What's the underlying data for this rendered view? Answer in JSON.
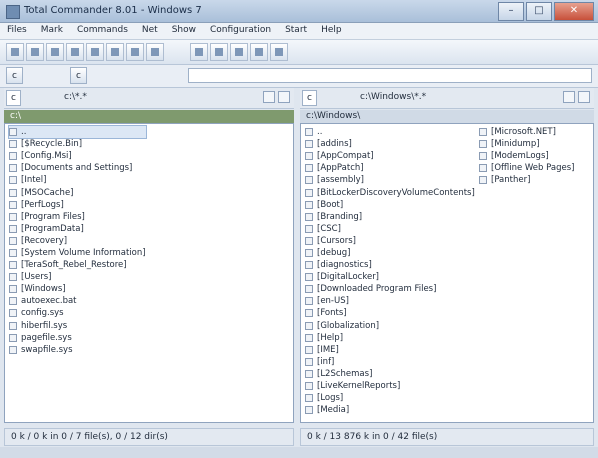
{
  "window": {
    "title": "Total Commander 8.01 - Windows 7"
  },
  "menu": [
    "Files",
    "Mark",
    "Commands",
    "Net",
    "Show",
    "Configuration",
    "Start",
    "Help"
  ],
  "drives": {
    "left": "c",
    "right": "c",
    "toolbar_left": "c",
    "toolbar_right": "c"
  },
  "left": {
    "path": "c:\\*.*",
    "header": "c:\\",
    "items": [
      "..",
      "[$Recycle.Bin]",
      "[Config.Msi]",
      "[Documents and Settings]",
      "[Intel]",
      "[MSOCache]",
      "[PerfLogs]",
      "[Program Files]",
      "[ProgramData]",
      "[Recovery]",
      "[System Volume Information]",
      "[TeraSoft_Rebel_Restore]",
      "[Users]",
      "[Windows]",
      "autoexec.bat",
      "config.sys",
      "hiberfil.sys",
      "pagefile.sys",
      "swapfile.sys"
    ],
    "status": "0 k / 0 k in 0 / 7 file(s), 0 / 12 dir(s)"
  },
  "right": {
    "path": "c:\\Windows\\*.*",
    "header": "c:\\Windows\\",
    "items_col1": [
      "..",
      "[addins]",
      "[AppCompat]",
      "[AppPatch]",
      "[assembly]",
      "[BitLockerDiscoveryVolumeContents]",
      "[Boot]",
      "[Branding]",
      "[CSC]",
      "[Cursors]",
      "[debug]",
      "[diagnostics]",
      "[DigitalLocker]",
      "[Downloaded Program Files]",
      "[en-US]",
      "[Fonts]",
      "[Globalization]",
      "[Help]",
      "[IME]",
      "[inf]",
      "[L2Schemas]",
      "[LiveKernelReports]",
      "[Logs]",
      "[Media]"
    ],
    "items_col2": [
      "[Microsoft.NET]",
      "[Minidump]",
      "[ModemLogs]",
      "[Offline Web Pages]",
      "[Panther]"
    ],
    "status": "0 k / 13 876 k in 0 / 42 file(s)"
  }
}
